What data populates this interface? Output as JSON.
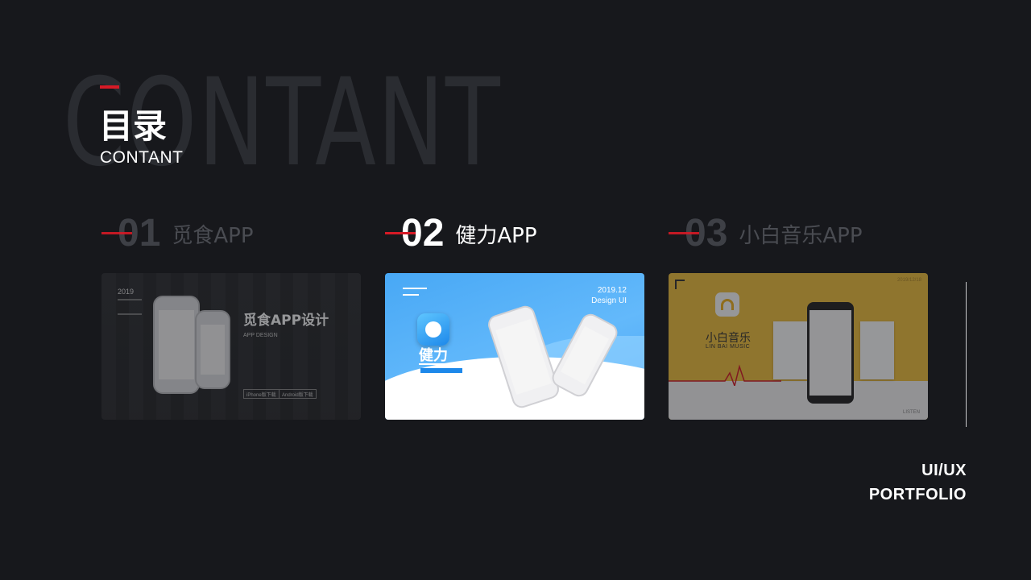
{
  "background_word": "CONTANT",
  "title": {
    "cn": "目录",
    "en": "CONTANT"
  },
  "items": [
    {
      "number": "01",
      "name": "觅食APP",
      "active": false,
      "card": {
        "year": "2019",
        "heading": "觅食APP设计",
        "tagline": "APP DESIGN",
        "buttons": [
          "iPhone版下载",
          "Android版下载"
        ]
      }
    },
    {
      "number": "02",
      "name": "健力APP",
      "active": true,
      "card": {
        "date": "2019.12",
        "subtitle": "Design UI",
        "app_name": "健力"
      }
    },
    {
      "number": "03",
      "name": "小白音乐APP",
      "active": false,
      "card": {
        "app_name": "小白音乐",
        "app_sub": "LIN BAI MUSIC",
        "date": "2019/12/18",
        "listen": "LISTEN"
      }
    }
  ],
  "corner": {
    "line1": "UI/UX",
    "line2": "PORTFOLIO"
  },
  "colors": {
    "background": "#17181c",
    "accent": "#d61a26",
    "card2_blue": "#4aa4f3",
    "card3_yellow": "#f2c13e"
  }
}
